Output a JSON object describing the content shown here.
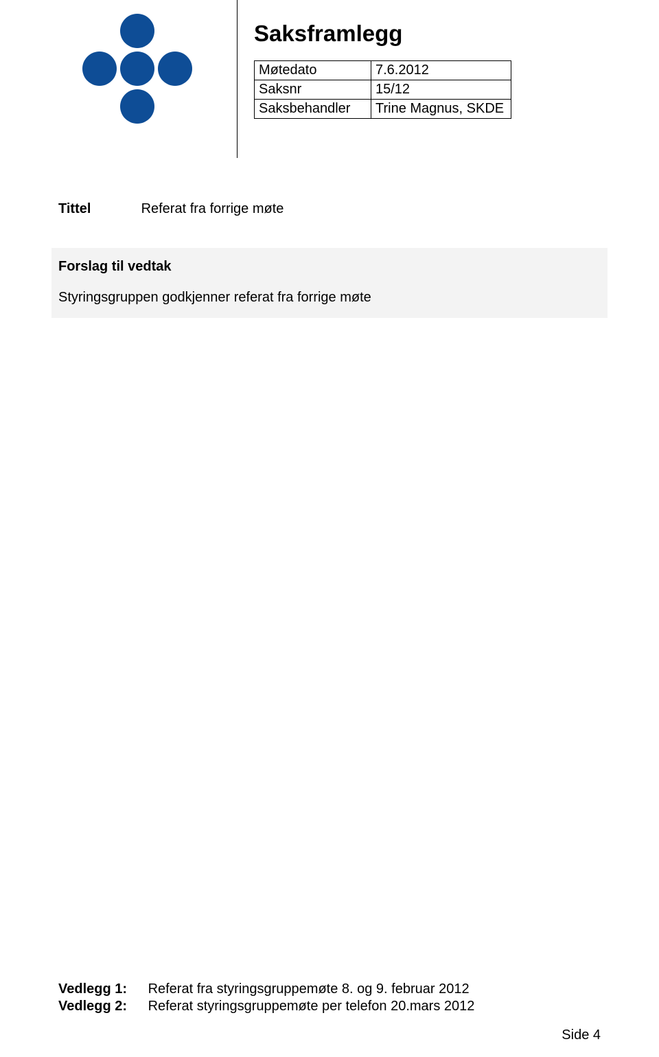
{
  "header": {
    "title": "Saksframlegg",
    "meta_rows": [
      {
        "label": "Møtedato",
        "value": "7.6.2012"
      },
      {
        "label": "Saksnr",
        "value": "15/12"
      },
      {
        "label": "Saksbehandler",
        "value": "Trine Magnus, SKDE"
      }
    ]
  },
  "title_section": {
    "label": "Tittel",
    "value": "Referat fra forrige møte"
  },
  "forslag": {
    "heading": "Forslag til vedtak",
    "body": "Styringsgruppen godkjenner referat fra forrige møte"
  },
  "vedlegg": [
    {
      "label": "Vedlegg 1:",
      "text": "Referat fra styringsgruppemøte 8. og 9. februar 2012"
    },
    {
      "label": "Vedlegg 2:",
      "text": "Referat styringsgruppemøte per telefon 20.mars 2012"
    }
  ],
  "footer": {
    "page": "Side 4"
  },
  "colors": {
    "logo_blue": "#0e4d96"
  }
}
